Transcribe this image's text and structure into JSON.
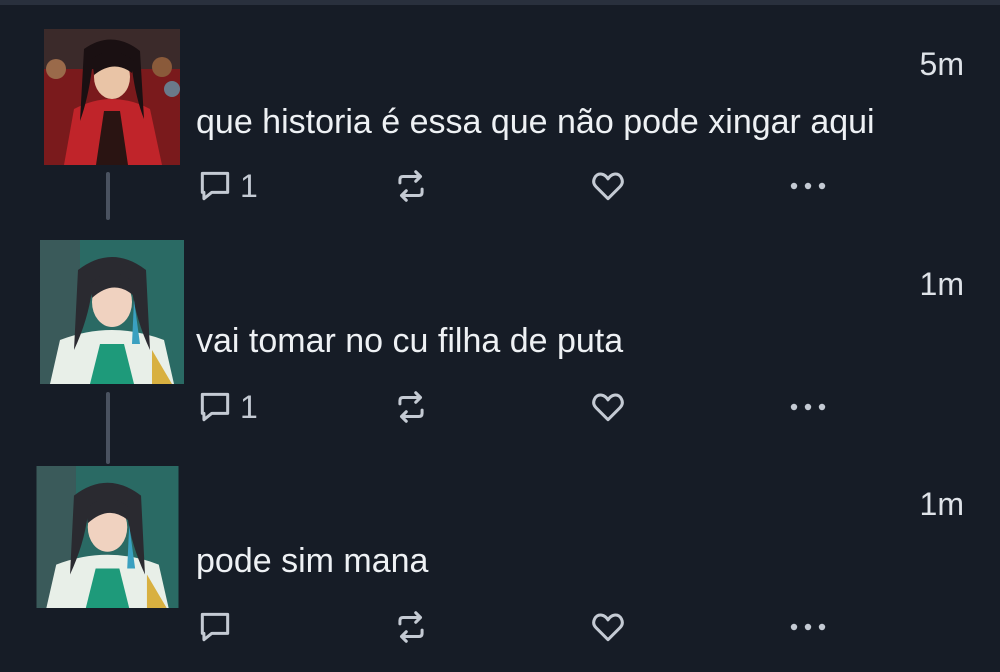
{
  "tweets": [
    {
      "time": "5m",
      "text": "que historia é essa que não pode xingar aqui",
      "reply_count": "1",
      "icons": [
        "reply-icon",
        "retweet-icon",
        "like-icon",
        "more-icon"
      ]
    },
    {
      "time": "1m",
      "text": "vai tomar no cu filha de puta",
      "reply_count": "1",
      "icons": [
        "reply-icon",
        "retweet-icon",
        "like-icon",
        "more-icon"
      ]
    },
    {
      "time": "1m",
      "text": "pode sim mana",
      "reply_count": "",
      "icons": [
        "reply-icon",
        "retweet-icon",
        "like-icon",
        "more-icon"
      ]
    }
  ],
  "colors": {
    "background": "#161c26",
    "text": "#eef1f4",
    "icon": "#c4cad3",
    "connector": "#4a5260"
  }
}
